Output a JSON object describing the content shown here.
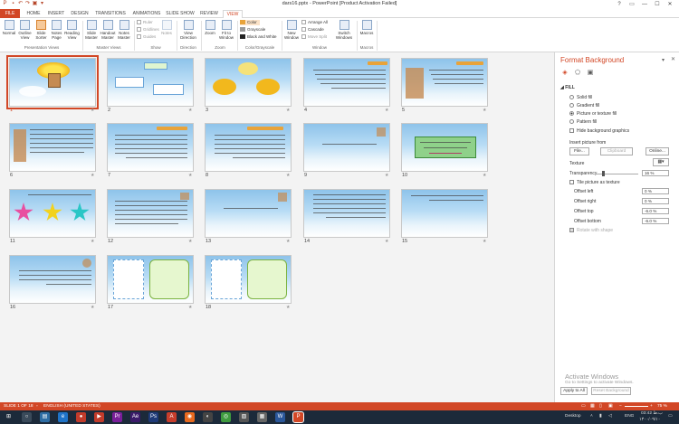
{
  "window": {
    "title": "dars16.pptx - PowerPoint [Product Activation Failed]",
    "controls": [
      "?",
      "▭",
      "—",
      "☐",
      "✕"
    ]
  },
  "quick_access": [
    "save-icon",
    "undo-icon",
    "redo-icon",
    "start-slideshow-icon",
    "customize-icon"
  ],
  "tabs": [
    "FILE",
    "HOME",
    "INSERT",
    "DESIGN",
    "TRANSITIONS",
    "ANIMATIONS",
    "SLIDE SHOW",
    "REVIEW",
    "VIEW"
  ],
  "active_tab": "VIEW",
  "ribbon": {
    "presentation_views": {
      "label": "Presentation Views",
      "buttons": [
        "Normal",
        "Outline View",
        "Slide Sorter",
        "Notes Page",
        "Reading View"
      ]
    },
    "master_views": {
      "label": "Master Views",
      "buttons": [
        "Slide Master",
        "Handout Master",
        "Notes Master"
      ]
    },
    "show": {
      "label": "Show",
      "items": [
        "Ruler",
        "Gridlines",
        "Guides"
      ],
      "notes": "Notes"
    },
    "direction": {
      "label": "Direction",
      "button": "View Direction"
    },
    "zoom": {
      "label": "Zoom",
      "buttons": [
        "Zoom",
        "Fit to Window"
      ]
    },
    "color": {
      "label": "Color/Grayscale",
      "items": [
        {
          "label": "Color",
          "swatch": "#e8a33a"
        },
        {
          "label": "Grayscale",
          "swatch": "#9a9a9a"
        },
        {
          "label": "Black and White",
          "swatch": "#222222"
        }
      ]
    },
    "window": {
      "label": "Window",
      "new_window": "New Window",
      "items": [
        "Arrange All",
        "Cascade",
        "Move Split"
      ],
      "switch": "Switch Windows"
    },
    "macros": {
      "label": "Macros",
      "button": "Macros"
    }
  },
  "slides": [
    "1",
    "2",
    "3",
    "4",
    "5",
    "6",
    "7",
    "8",
    "9",
    "10",
    "11",
    "12",
    "13",
    "14",
    "15",
    "16",
    "17",
    "18"
  ],
  "selected_slide": "1",
  "format_pane": {
    "title": "Format Background",
    "section": "FILL",
    "fill_options": [
      {
        "label": "Solid fill",
        "checked": false
      },
      {
        "label": "Gradient fill",
        "checked": false
      },
      {
        "label": "Picture or texture fill",
        "checked": true
      },
      {
        "label": "Pattern fill",
        "checked": false
      }
    ],
    "hide_graphics": "Hide background graphics",
    "insert_from": "Insert picture from",
    "file_btn": "File...",
    "clipboard_btn": "Clipboard",
    "online_btn": "Online...",
    "texture_label": "Texture",
    "transparency_label": "Transparency",
    "transparency_value": "16 %",
    "transparency_fraction": 0.16,
    "tile_label": "Tile picture as texture",
    "offsets": [
      {
        "label": "Offset left",
        "value": "0 %"
      },
      {
        "label": "Offset right",
        "value": "0 %"
      },
      {
        "label": "Offset top",
        "value": "-6.0 %"
      },
      {
        "label": "Offset bottom",
        "value": "-6.0 %"
      }
    ],
    "rotate_label": "Rotate with shape",
    "apply_all": "Apply to All",
    "reset": "Reset Background"
  },
  "watermark": {
    "line1": "Activate Windows",
    "line2": "Go to Settings to activate Windows."
  },
  "status": {
    "slide": "SLIDE 1 OF 18",
    "language": "ENGLISH (UNITED STATES)",
    "zoom": "75 %"
  },
  "taskbar": {
    "desktop": "Desktop",
    "lang": "ENG",
    "time": "03:42 ب.ظ",
    "date": "۱۴۰۰/۰۹/۱۰"
  }
}
